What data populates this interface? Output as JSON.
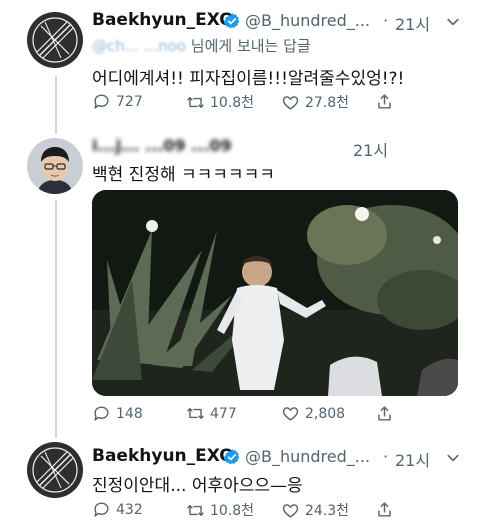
{
  "tweets": [
    {
      "name": "Baekhyun_EXO",
      "handle": "@B_hundred_...",
      "separator": "·",
      "time": "21시",
      "replying_mention": "@ch... ...noo",
      "replying_suffix": "님에게 보내는 답글",
      "text": "어디에계셔!! 피자집이름!!!알려줄수있엉!?!",
      "stats": {
        "replies": "727",
        "retweets": "10.8천",
        "likes": "27.8천"
      }
    },
    {
      "name": "i...j... ...09 ...09",
      "time": "21시",
      "text": "백현 진정해 ㅋㅋㅋㅋㅋㅋ",
      "stats": {
        "replies": "148",
        "retweets": "477",
        "likes": "2,808"
      }
    },
    {
      "name": "Baekhyun_EXO",
      "handle": "@B_hundred_...",
      "separator": "·",
      "time": "21시",
      "text": "진정이안대... 어후아으으—응",
      "stats": {
        "replies": "432",
        "retweets": "10.8천",
        "likes": "24.3천"
      }
    }
  ],
  "colors": {
    "verified": "#1d9bf0",
    "secondary_text": "#536471",
    "thread_line": "#cfd9de"
  },
  "icons": [
    "reply-icon",
    "retweet-icon",
    "like-icon",
    "share-icon",
    "verified-badge-icon"
  ]
}
